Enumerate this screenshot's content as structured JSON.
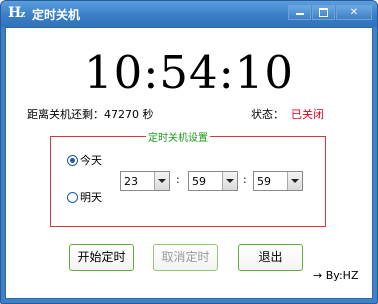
{
  "window": {
    "icon_text": "H",
    "icon_sub": "z",
    "title": "定时关机",
    "min_label": "",
    "max_label": "",
    "close_label": "✕"
  },
  "clock": {
    "time": "10:54:10"
  },
  "remaining": {
    "text": "距离关机还剩：47270 秒"
  },
  "status": {
    "label": "状态：",
    "value": "已关闭",
    "value_color": "#e0001a"
  },
  "settings": {
    "title": "定时关机设置",
    "option_today": "今天",
    "option_tomorrow": "明天",
    "selected_option": "today",
    "hour": "23",
    "minute": "59",
    "second": "59",
    "separator": ":"
  },
  "buttons": {
    "start": "开始定时",
    "cancel": "取消定时",
    "exit": "退出"
  },
  "footer": {
    "byline": "→ By:HZ"
  },
  "icons": [
    "minimize-icon",
    "maximize-icon",
    "close-icon",
    "dropdown-arrow-icon",
    "radio-icon"
  ]
}
